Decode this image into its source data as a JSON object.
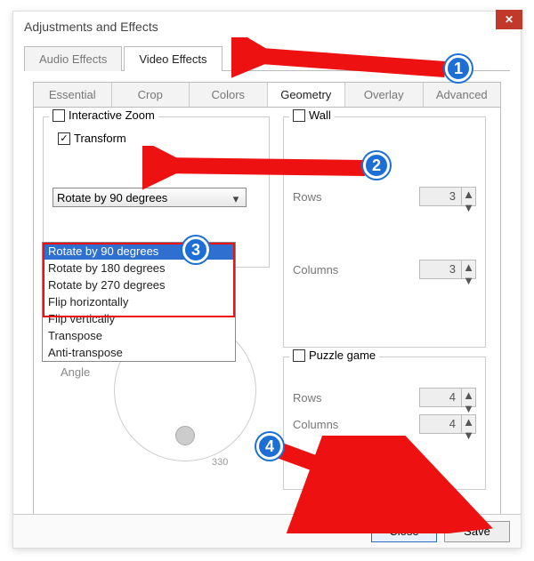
{
  "window": {
    "title": "Adjustments and Effects",
    "close_glyph": "✕"
  },
  "tabs_top": {
    "audio": "Audio Effects",
    "video": "Video Effects",
    "active": "video"
  },
  "tabs_sub": {
    "essential": "Essential",
    "crop": "Crop",
    "colors": "Colors",
    "geometry": "Geometry",
    "overlay": "Overlay",
    "advanced": "Advanced",
    "active": "geometry"
  },
  "left": {
    "interactive_zoom": {
      "label": "Interactive Zoom",
      "checked": false
    },
    "transform": {
      "label": "Transform",
      "checked": true,
      "selected": "Rotate by 90 degrees",
      "options": [
        "Rotate by 90 degrees",
        "Rotate by 180 degrees",
        "Rotate by 270 degrees",
        "Flip horizontally",
        "Flip vertically",
        "Transpose",
        "Anti-transpose"
      ]
    },
    "angle": {
      "label": "Angle",
      "tick": "330"
    }
  },
  "right": {
    "wall": {
      "label": "Wall",
      "checked": false,
      "rows_label": "Rows",
      "rows_value": "3",
      "cols_label": "Columns",
      "cols_value": "3"
    },
    "puzzle": {
      "label": "Puzzle game",
      "checked": false,
      "rows_label": "Rows",
      "rows_value": "4",
      "cols_label": "Columns",
      "cols_value": "4"
    }
  },
  "buttons": {
    "close": "Close",
    "save": "Save"
  },
  "callouts": {
    "c1": "1",
    "c2": "2",
    "c3": "3",
    "c4": "4"
  },
  "spinner_arrows": {
    "up": "▲",
    "down": "▼"
  },
  "combo_caret": "▾",
  "check_glyph": "✓"
}
